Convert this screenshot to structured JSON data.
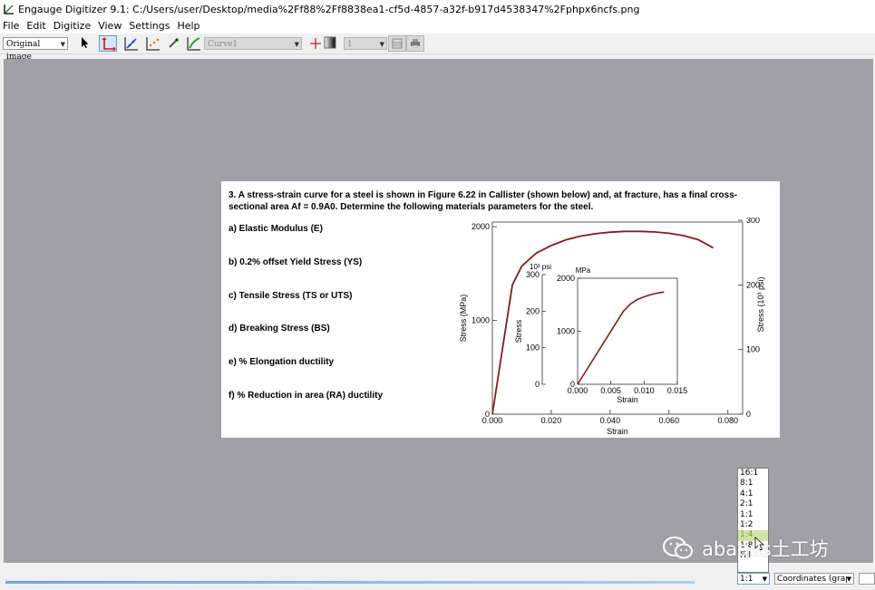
{
  "window": {
    "title": "Engauge Digitizer 9.1: C:/Users/user/Desktop/media%2Ff88%2Ff8838ea1-cf5d-4857-a32f-b917d4538347%2Fphpx6ncfs.png"
  },
  "menu": [
    "File",
    "Edit",
    "Digitize",
    "View",
    "Settings",
    "Help"
  ],
  "toolbar": {
    "background_select": "Original image",
    "curve_select": "Curve1",
    "point_count": "1"
  },
  "image": {
    "question_line1": "3. A stress-strain curve for a steel is shown in Figure 6.22 in Callister (shown below) and, at fracture, has a final cross-",
    "question_line2": "sectional area Af = 0.9A0. Determine the following materials parameters for the steel.",
    "items": [
      "a)  Elastic Modulus (E)",
      "b)  0.2% offset Yield Stress (YS)",
      "c)  Tensile Stress (TS or UTS)",
      "d)  Breaking Stress (BS)",
      "e)  % Elongation ductility",
      "f)  % Reduction in area (RA) ductility"
    ]
  },
  "chart_data": [
    {
      "type": "line",
      "xlabel": "Strain",
      "ylabel": "Stress (MPa)",
      "ylabel_right": "Stress (10³ psi)",
      "xlim": [
        0,
        0.085
      ],
      "ylim": [
        0,
        2000
      ],
      "x_ticks": [
        "0.000",
        "0.020",
        "0.040",
        "0.060",
        "0.080"
      ],
      "y_ticks": [
        "0",
        "1000",
        "2000"
      ],
      "y_ticks_right": [
        "0",
        "100",
        "200",
        "300"
      ],
      "series": [
        {
          "x": [
            0,
            0.0068,
            0.01,
            0.015,
            0.02,
            0.025,
            0.03,
            0.035,
            0.04,
            0.045,
            0.05,
            0.055,
            0.06,
            0.065,
            0.07,
            0.075
          ],
          "y": [
            0,
            1380,
            1580,
            1720,
            1800,
            1860,
            1900,
            1925,
            1942,
            1950,
            1950,
            1945,
            1930,
            1905,
            1860,
            1775
          ]
        }
      ],
      "color": "#8b1a1a"
    },
    {
      "type": "line",
      "xlabel": "Strain",
      "ylabel": "Stress",
      "ylabel_left_unit": "10³ psi",
      "ylabel_right_unit": "MPa",
      "xlim": [
        0,
        0.015
      ],
      "ylim": [
        0,
        2000
      ],
      "x_ticks": [
        "0.000",
        "0.005",
        "0.010",
        "0.015"
      ],
      "y_ticks_mpa": [
        "0",
        "1000",
        "2000"
      ],
      "y_ticks_psi": [
        "0",
        "100",
        "200",
        "300"
      ],
      "series": [
        {
          "x": [
            0,
            0.0069,
            0.008,
            0.009,
            0.01,
            0.011,
            0.012,
            0.013
          ],
          "y": [
            0,
            1380,
            1520,
            1600,
            1650,
            1690,
            1720,
            1740
          ]
        }
      ],
      "color": "#8b1a1a"
    }
  ],
  "status": {
    "zoom": "1:1",
    "coordinates": "Coordinates (grap"
  },
  "zoom_options": [
    "16:1",
    "8:1",
    "4:1",
    "2:1",
    "1:1",
    "1:2",
    "1:4",
    "1:8",
    "Fill"
  ],
  "zoom_highlight": "1:4",
  "watermark": "abaqus土工坊"
}
